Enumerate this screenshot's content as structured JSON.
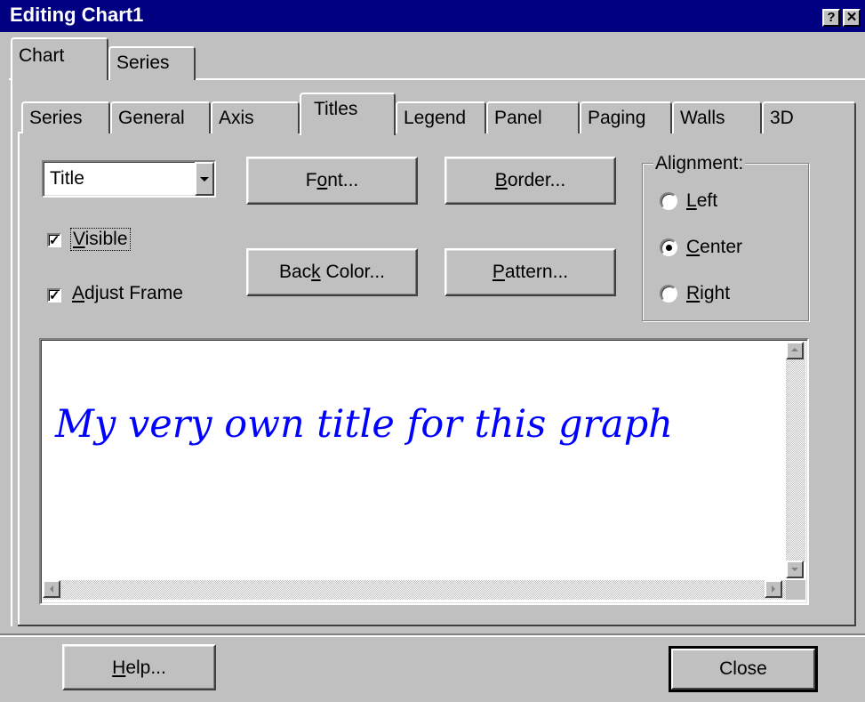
{
  "window": {
    "title": "Editing Chart1",
    "help_glyph": "?",
    "close_glyph": "✕"
  },
  "outer_tabs": [
    {
      "label": "Chart",
      "selected": true
    },
    {
      "label": "Series",
      "selected": false
    }
  ],
  "inner_tabs": [
    {
      "label": "Series",
      "selected": false
    },
    {
      "label": "General",
      "selected": false
    },
    {
      "label": "Axis",
      "selected": false
    },
    {
      "label": "Titles",
      "selected": true
    },
    {
      "label": "Legend",
      "selected": false
    },
    {
      "label": "Panel",
      "selected": false
    },
    {
      "label": "Paging",
      "selected": false
    },
    {
      "label": "Walls",
      "selected": false
    },
    {
      "label": "3D",
      "selected": false
    }
  ],
  "title_select": {
    "value": "Title"
  },
  "checkboxes": {
    "visible": {
      "pre": "",
      "mnemonic": "V",
      "post": "isible",
      "checked": true
    },
    "adjust_frame": {
      "pre": "",
      "mnemonic": "A",
      "post": "djust Frame",
      "checked": true
    }
  },
  "buttons": {
    "font": {
      "pre": "F",
      "mnemonic": "o",
      "post": "nt..."
    },
    "border": {
      "pre": "",
      "mnemonic": "B",
      "post": "order..."
    },
    "back_color": {
      "pre": "Bac",
      "mnemonic": "k",
      "post": " Color..."
    },
    "pattern": {
      "pre": "",
      "mnemonic": "P",
      "post": "attern..."
    },
    "help": {
      "pre": "",
      "mnemonic": "H",
      "post": "elp..."
    },
    "close": {
      "label": "Close"
    }
  },
  "alignment": {
    "legend": "Alignment:",
    "options": [
      {
        "pre": "",
        "mnemonic": "L",
        "post": "eft",
        "selected": false
      },
      {
        "pre": "",
        "mnemonic": "C",
        "post": "enter",
        "selected": true
      },
      {
        "pre": "",
        "mnemonic": "R",
        "post": "ight",
        "selected": false
      }
    ]
  },
  "title_text": {
    "value": "My very own title for this graph",
    "color": "#0000ff"
  },
  "colors": {
    "face": "#c0c0c0",
    "titlebar": "#000080",
    "title_text": "#0000ff"
  }
}
